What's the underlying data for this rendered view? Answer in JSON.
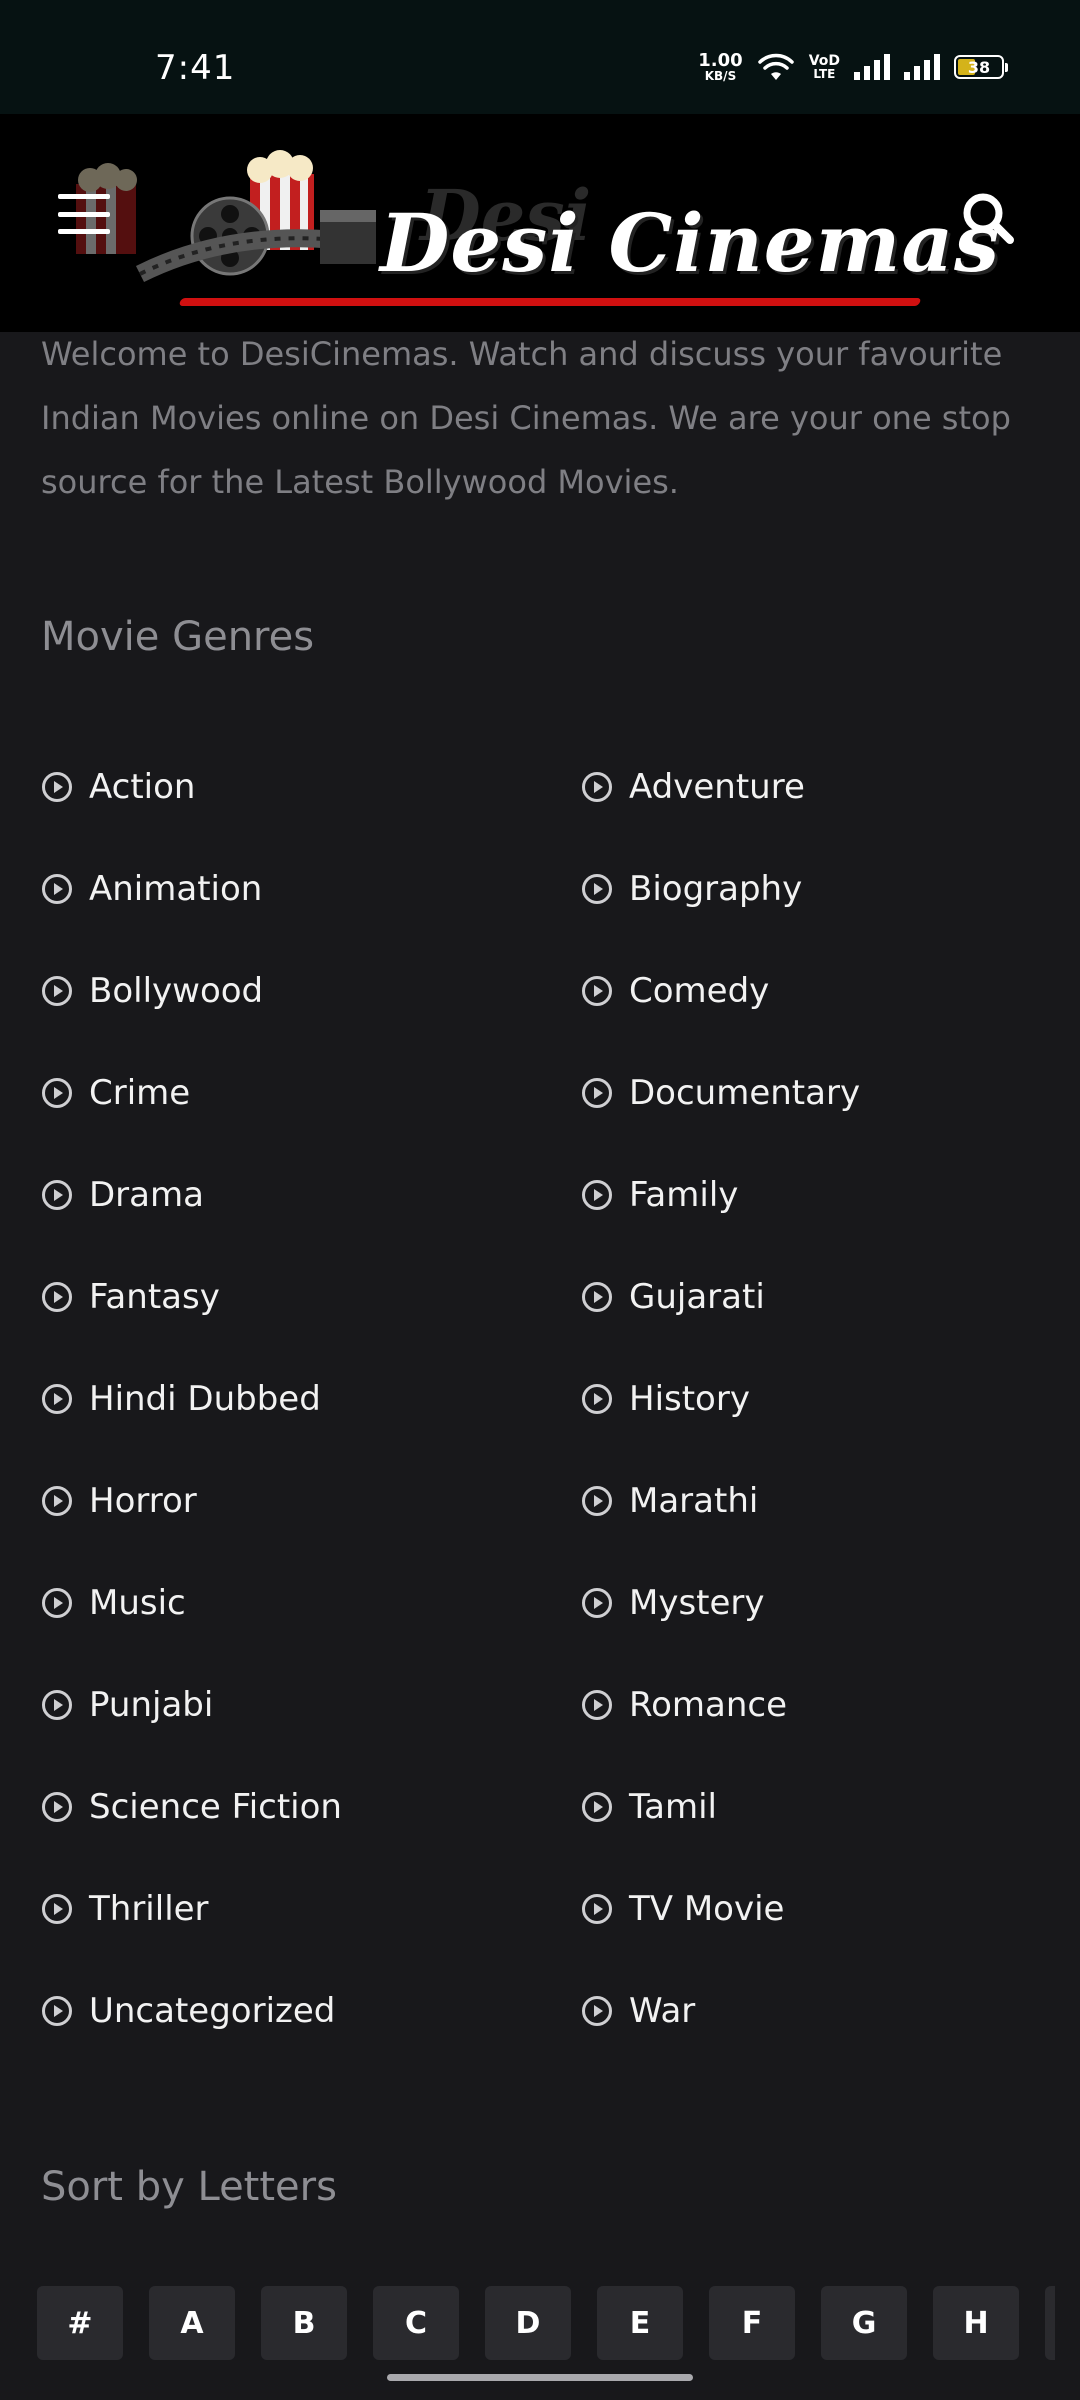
{
  "status_bar": {
    "time": "7:41",
    "net_speed_value": "1.00",
    "net_speed_unit": "KB/S",
    "volte_top": "VoD",
    "volte_bottom": "LTE",
    "battery_level": "38",
    "battery_fill_percent": 38,
    "icons": [
      "wifi-icon",
      "signal-icon",
      "signal-icon",
      "battery-icon"
    ]
  },
  "header": {
    "logo_text": "Desi Cinemas",
    "menu_icon": "hamburger-icon",
    "search_icon": "search-icon"
  },
  "intro": {
    "text": "Welcome to DesiCinemas. Watch and discuss your favourite Indian Movies online on Desi Cinemas. We are your one stop source for the Latest Bollywood Movies."
  },
  "genres": {
    "title": "Movie Genres",
    "items": [
      "Action",
      "Adventure",
      "Animation",
      "Biography",
      "Bollywood",
      "Comedy",
      "Crime",
      "Documentary",
      "Drama",
      "Family",
      "Fantasy",
      "Gujarati",
      "Hindi Dubbed",
      "History",
      "Horror",
      "Marathi",
      "Music",
      "Mystery",
      "Punjabi",
      "Romance",
      "Science Fiction",
      "Tamil",
      "Thriller",
      "TV Movie",
      "Uncategorized",
      "War"
    ],
    "item_icon": "play-circle-icon"
  },
  "letters": {
    "title": "Sort by Letters",
    "items": [
      "#",
      "A",
      "B",
      "C",
      "D",
      "E",
      "F",
      "G",
      "H"
    ]
  },
  "colors": {
    "background": "#18181b",
    "header": "#000000",
    "status_bar": "#061212",
    "accent_red": "#d01010",
    "muted_text": "#7f7f84",
    "letter_button": "#2a2a2e"
  }
}
